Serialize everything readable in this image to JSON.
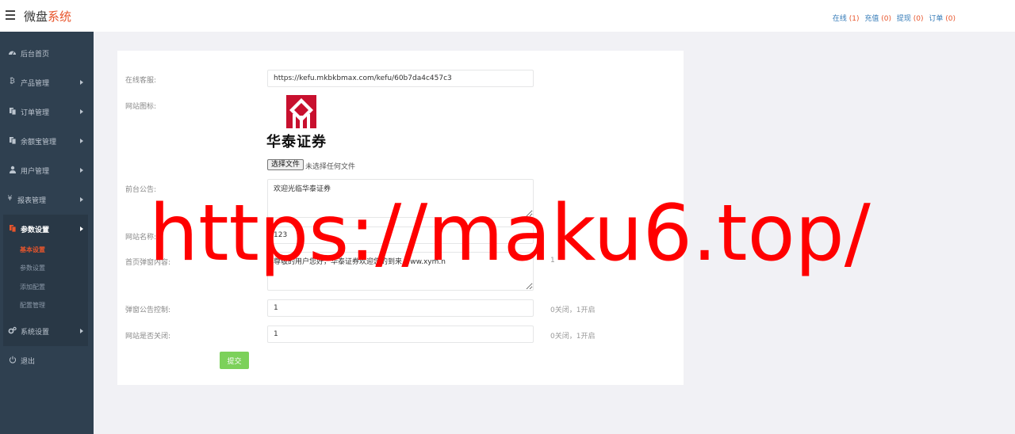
{
  "header": {
    "brand_main": "微盘",
    "brand_accent": "系统",
    "stats": [
      {
        "label": "在线",
        "count": "(1)"
      },
      {
        "label": "充值",
        "count": "(0)"
      },
      {
        "label": "提现",
        "count": "(0)"
      },
      {
        "label": "订单",
        "count": "(0)"
      }
    ]
  },
  "sidebar": {
    "items": [
      {
        "label": "后台首页",
        "icon": "dashboard-icon"
      },
      {
        "label": "产品管理",
        "icon": "bitcoin-icon"
      },
      {
        "label": "订单管理",
        "icon": "copy-icon"
      },
      {
        "label": "余额宝管理",
        "icon": "copy-icon"
      },
      {
        "label": "用户管理",
        "icon": "user-icon"
      },
      {
        "label": "报表管理",
        "icon": "yen-icon"
      },
      {
        "label": "参数设置",
        "icon": "copy-icon"
      },
      {
        "label": "系统设置",
        "icon": "gears-icon"
      },
      {
        "label": "退出",
        "icon": "power-icon"
      }
    ],
    "sub_items": [
      "基本设置",
      "参数设置",
      "添加配置",
      "配置管理"
    ]
  },
  "form": {
    "kefu_label": "在线客服:",
    "kefu_value": "https://kefu.mkbkbmax.com/kefu/60b7da4c457c3",
    "icon_label": "网站图标:",
    "logo_text": "华泰证券",
    "file_button": "选择文件",
    "file_status": "未选择任何文件",
    "notice_label": "前台公告:",
    "notice_value": "欢迎光临华泰证券",
    "site_name_label": "网站名称:",
    "site_name_value": "123",
    "popup_label": "首页弹窗内容:",
    "popup_value": "尊敬的用户您好，华泰证券欢迎您的到来 www.xym.n",
    "popup_hint": "1",
    "popup_ctrl_label": "弹窗公告控制:",
    "popup_ctrl_value": "1",
    "popup_ctrl_hint": "0关闭，1开启",
    "site_close_label": "网站是否关闭:",
    "site_close_value": "1",
    "site_close_hint": "0关闭，1开启",
    "submit_label": "提交"
  },
  "colors": {
    "sidebar_bg": "#2f4050",
    "accent": "#e8552c",
    "submit": "#7cd15a",
    "watermark": "#ff0000"
  },
  "watermark": "https://maku6.top/"
}
